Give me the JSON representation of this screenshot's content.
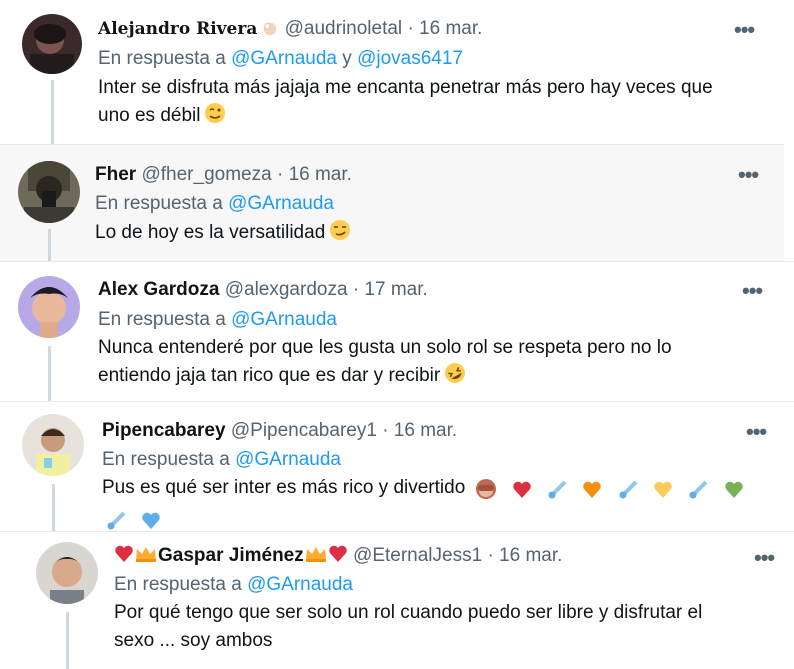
{
  "tweets": [
    {
      "name": "Alejandro Rivera",
      "handle": "@audrinoletal",
      "sep": "·",
      "date": "16 mar.",
      "reply_prefix": "En respuesta a",
      "mentions": [
        "@GArnauda",
        "@jovas6417"
      ],
      "mention_joiner": "y",
      "text_line1": "Inter se disfruta más jajaja me encanta penetrar más pero hay veces que",
      "text_line2": "uno es débil",
      "more": "•••"
    },
    {
      "name": "Fher",
      "handle": "@fher_gomeza",
      "sep": "·",
      "date": "16 mar.",
      "reply_prefix": "En respuesta a",
      "mentions": [
        "@GArnauda"
      ],
      "text_line1": "Lo de hoy es la versatilidad",
      "more": "•••"
    },
    {
      "name": "Alex Gardoza",
      "handle": "@alexgardoza",
      "sep": "·",
      "date": "17 mar.",
      "reply_prefix": "En respuesta a",
      "mentions": [
        "@GArnauda"
      ],
      "text_line1": "Nunca entenderé por que les gusta un solo rol se respeta pero no lo",
      "text_line2": "entiendo jaja tan rico que es dar y recibir",
      "more": "•••"
    },
    {
      "name": "Pipencabarey",
      "handle": "@Pipencabarey1",
      "sep": "·",
      "date": "16 mar.",
      "reply_prefix": "En respuesta a",
      "mentions": [
        "@GArnauda"
      ],
      "text_line1": "Pus es qué ser inter es más rico y divertido",
      "more": "•••"
    },
    {
      "name": "Gaspar Jiménez",
      "handle": "@EternalJess1",
      "sep": "·",
      "date": "16 mar.",
      "reply_prefix": "En respuesta a",
      "mentions": [
        "@GArnauda"
      ],
      "text_line1": "Por qué tengo que ser solo un rol cuando puedo ser libre y disfrutar el",
      "text_line2": "sexo ... soy ambos",
      "more": "•••"
    }
  ],
  "colors": {
    "mention": "#1d9bf0",
    "secondary_text": "#536471",
    "thread_line": "#cfd9de",
    "highlight_bg": "#f7f7f7"
  },
  "icons": [
    "wink-face-icon",
    "smirk-face-icon",
    "rolling-laughing-face-icon",
    "see-no-evil-monkey-icon",
    "heart-icon",
    "comet-icon",
    "crown-icon",
    "more-options-icon"
  ]
}
